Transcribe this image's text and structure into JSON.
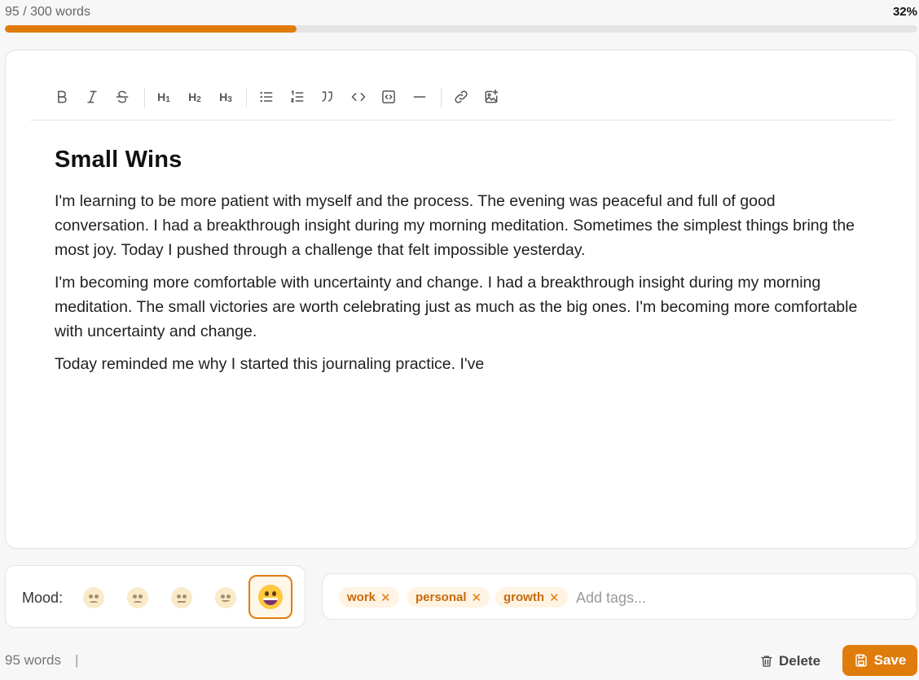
{
  "progress": {
    "word_goal_text": "95 / 300 words",
    "percent_text": "32%",
    "fraction": 0.32,
    "accent": "#e07c0c"
  },
  "toolbar": {
    "buttons": [
      {
        "name": "bold",
        "icon": "bold-icon"
      },
      {
        "name": "italic",
        "icon": "italic-icon"
      },
      {
        "name": "strikethrough",
        "icon": "strikethrough-icon"
      },
      {
        "name": "heading-1",
        "label": "H",
        "sub": "1"
      },
      {
        "name": "heading-2",
        "label": "H",
        "sub": "2"
      },
      {
        "name": "heading-3",
        "label": "H",
        "sub": "3"
      },
      {
        "name": "bullet-list",
        "icon": "bullet-list-icon"
      },
      {
        "name": "numbered-list",
        "icon": "numbered-list-icon"
      },
      {
        "name": "quote",
        "icon": "quote-icon"
      },
      {
        "name": "inline-code",
        "icon": "code-icon"
      },
      {
        "name": "code-block",
        "icon": "code-block-icon"
      },
      {
        "name": "horizontal-rule",
        "icon": "horizontal-rule-icon"
      },
      {
        "name": "link",
        "icon": "link-icon"
      },
      {
        "name": "image",
        "icon": "image-add-icon"
      }
    ]
  },
  "entry": {
    "title": "Small Wins",
    "paragraphs": [
      "I'm learning to be more patient with myself and the process. The evening was peaceful and full of good conversation. I had a breakthrough insight during my morning meditation. Sometimes the simplest things bring the most joy. Today I pushed through a challenge that felt impossible yesterday.",
      "I'm becoming more comfortable with uncertainty and change. I had a breakthrough insight during my morning meditation. The small victories are worth celebrating just as much as the big ones. I'm becoming more comfortable with uncertainty and change.",
      "Today reminded me why I started this journaling practice. I've"
    ]
  },
  "mood": {
    "label": "Mood:",
    "options": [
      "very-sad-face-icon",
      "sad-face-icon",
      "neutral-face-icon",
      "slight-smile-face-icon",
      "grinning-face-icon"
    ],
    "selected": "grinning-face-icon"
  },
  "tags": {
    "items": [
      "work",
      "personal",
      "growth"
    ],
    "remove_glyph": "✕",
    "placeholder": "Add tags..."
  },
  "footer": {
    "word_count": "95 words",
    "separator": "|",
    "delete_label": "Delete",
    "save_label": "Save"
  }
}
